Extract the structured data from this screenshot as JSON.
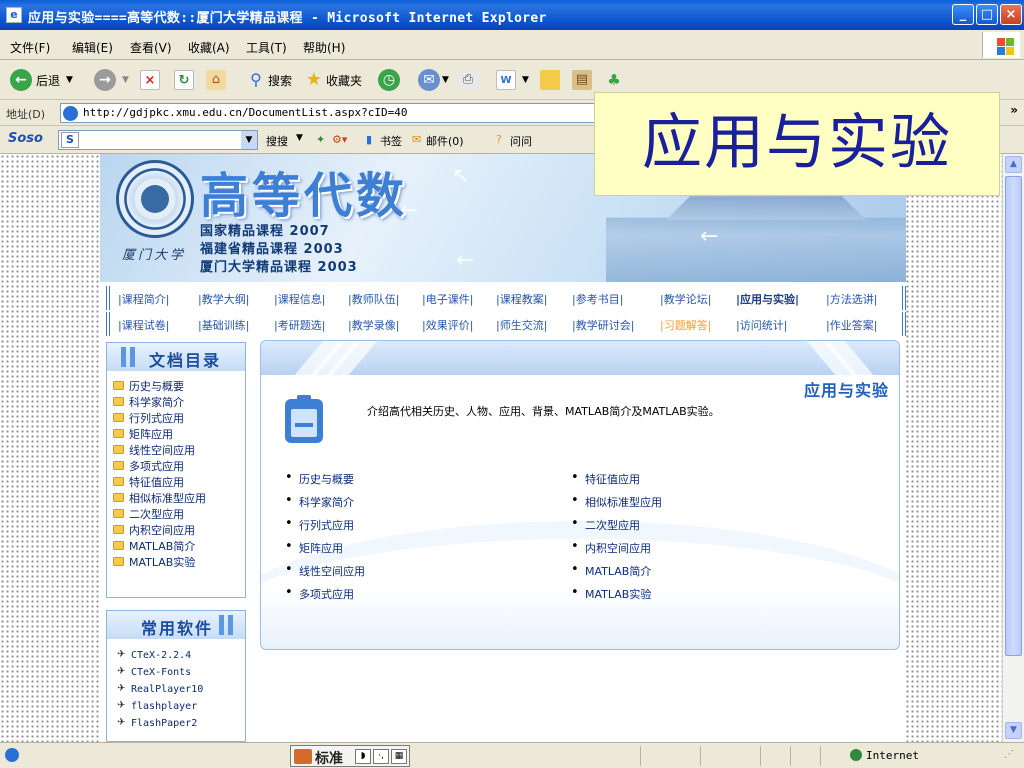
{
  "window": {
    "title": "应用与实验====高等代数::厦门大学精品课程 - Microsoft Internet Explorer",
    "minimize": "_",
    "maximize": "□",
    "close": "×"
  },
  "menubar": {
    "items": [
      "文件(F)",
      "编辑(E)",
      "查看(V)",
      "收藏(A)",
      "工具(T)",
      "帮助(H)"
    ]
  },
  "toolbar": {
    "back": "后退",
    "search": "搜索",
    "favorites": "收藏夹"
  },
  "addressbar": {
    "label": "地址(D)",
    "url": "http://gdjpkc.xmu.edu.cn/DocumentList.aspx?cID=40",
    "more": "»"
  },
  "sosobar": {
    "logo": "Soso",
    "s_icon": "S",
    "search_button": "搜搜",
    "bookmarks": "书签",
    "mail": "邮件(0)",
    "ask": "问问"
  },
  "overlay_title": "应用与实验",
  "banner": {
    "title": "高等代数",
    "lines": [
      "国家精品课程 2007",
      "福建省精品课程 2003",
      "厦门大学精品课程 2003"
    ],
    "signature": "厦门大学"
  },
  "nav": {
    "row1": [
      "|课程简介|",
      "|教学大纲|",
      "|课程信息|",
      "|教师队伍|",
      "|电子课件|",
      "|课程教案|",
      "|参考书目|",
      "|教学论坛|",
      "|应用与实验|",
      "|方法选讲|"
    ],
    "row2": [
      "|课程试卷|",
      "|基础训练|",
      "|考研题选|",
      "|教学录像|",
      "|效果评价|",
      "|师生交流|",
      "|教学研讨会|",
      "|习题解答|",
      "|访问统计|",
      "|作业答案|"
    ]
  },
  "sidebar": {
    "docs_title": "文档目录",
    "docs": [
      "历史与概要",
      "科学家简介",
      "行列式应用",
      "矩阵应用",
      "线性空间应用",
      "多项式应用",
      "特征值应用",
      "相似标准型应用",
      "二次型应用",
      "内积空间应用",
      "MATLAB简介",
      "MATLAB实验"
    ],
    "software_title": "常用软件",
    "software": [
      "CTeX-2.2.4",
      "CTeX-Fonts",
      "RealPlayer10",
      "flashplayer",
      "FlashPaper2"
    ]
  },
  "content": {
    "title": "应用与实验",
    "description": "介绍高代相关历史、人物、应用、背景、MATLAB简介及MATLAB实验。",
    "left_links": [
      "历史与概要",
      "科学家简介",
      "行列式应用",
      "矩阵应用",
      "线性空间应用",
      "多项式应用"
    ],
    "right_links": [
      "特征值应用",
      "相似标准型应用",
      "二次型应用",
      "内积空间应用",
      "MATLAB简介",
      "MATLAB实验"
    ]
  },
  "statusbar": {
    "ime_label": "标准",
    "zone": "Internet"
  }
}
